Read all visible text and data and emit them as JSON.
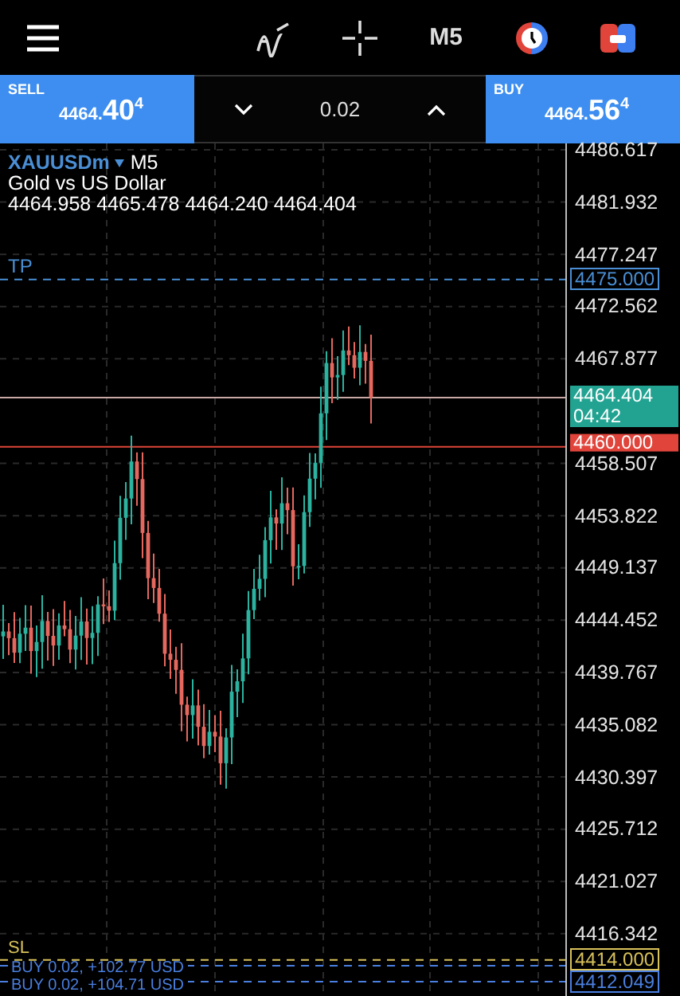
{
  "toolbar": {
    "timeframe": "M5"
  },
  "trade_panel": {
    "sell": {
      "label": "SELL",
      "price_small": "4464.",
      "price_big": "40",
      "price_sup": "4"
    },
    "volume": "0.02",
    "buy": {
      "label": "BUY",
      "price_small": "4464.",
      "price_big": "56",
      "price_sup": "4"
    }
  },
  "chart": {
    "symbol": "XAUUSDm",
    "timeframe": "M5",
    "description": "Gold vs US Dollar",
    "ohlc": "4464.958 4465.478 4464.240 4464.404",
    "price_axis": [
      "4486.617",
      "4481.932",
      "4477.247",
      "4472.562",
      "4467.877",
      "4458.507",
      "4453.822",
      "4449.137",
      "4444.452",
      "4439.767",
      "4435.082",
      "4430.397",
      "4425.712",
      "4421.027",
      "4416.342"
    ],
    "levels": [
      {
        "kind": "tp",
        "label": "TP",
        "price": "4475.000"
      },
      {
        "kind": "bid",
        "price": "4464.404",
        "countdown": "04:42"
      },
      {
        "kind": "alert",
        "price": "4460.000"
      },
      {
        "kind": "sl",
        "label": "SL",
        "price": "4414.000"
      },
      {
        "kind": "position",
        "label": "BUY 0.02, +102.77 USD"
      },
      {
        "kind": "position",
        "label": "BUY 0.02, +104.71 USD",
        "price": "4412.049"
      }
    ]
  }
}
